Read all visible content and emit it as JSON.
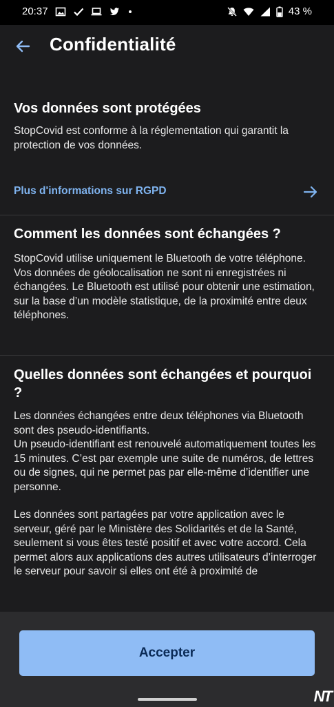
{
  "status_bar": {
    "time": "20:37",
    "battery": "43 %",
    "left_icons": [
      "image-icon",
      "check-icon",
      "laptop-icon",
      "twitter-icon",
      "dot-icon"
    ],
    "right_icons": [
      "muted-bell-icon",
      "wifi-icon",
      "signal-icon",
      "battery-icon"
    ]
  },
  "app_bar": {
    "title": "Confidentialité"
  },
  "sections": [
    {
      "title": "Vos données sont protégées",
      "body": "StopCovid est conforme à la réglementation qui garantit la protection de vos données."
    },
    {
      "title": "Comment les données sont échangées ?",
      "body": "StopCovid utilise uniquement le Bluetooth de votre téléphone. Vos données de géolocalisation ne sont ni enregistrées ni échangées. Le Bluetooth est utilisé pour obtenir une estimation, sur la base d’un modèle statistique, de la proximité entre deux téléphones."
    },
    {
      "title": "Quelles données sont échangées et pourquoi ?",
      "body_p1_line1": "Les données échangées entre deux téléphones via Bluetooth sont des pseudo-identifiants.",
      "body_p1_line2": "Un pseudo-identifiant est renouvelé automatiquement toutes les 15 minutes. C’est par exemple une suite de numéros, de lettres ou de signes, qui ne permet pas par elle-même d’identifier une personne.",
      "body_p2": "Les données sont partagées par votre application avec le serveur, géré par le Ministère des Solidarités et de la Santé, seulement si vous êtes testé positif et avec votre accord. Cela permet alors aux applications des autres utilisateurs d’interroger le serveur pour savoir si elles ont été à proximité de"
    }
  ],
  "link": {
    "label": "Plus d'informations sur RGPD"
  },
  "accept_button": {
    "label": "Accepter"
  },
  "watermark": "NT",
  "colors": {
    "background": "#1c1c1e",
    "link": "#7fb3ef",
    "button": "#8fbcf5",
    "button_text": "#0b2b57"
  }
}
